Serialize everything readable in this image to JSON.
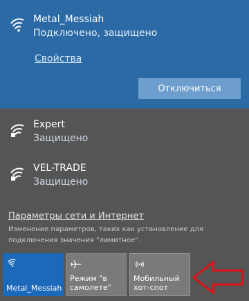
{
  "connected_network": {
    "name": "Metal_Messiah",
    "status": "Подключено, защищено",
    "properties_link": "Свойства",
    "disconnect_button": "Отключиться",
    "icon": "wifi-icon"
  },
  "networks": [
    {
      "name": "Expert",
      "status": "Защищено",
      "icon": "wifi-secured-icon"
    },
    {
      "name": "VEL-TRADE",
      "status": "Защищено",
      "icon": "wifi-secured-icon"
    }
  ],
  "settings": {
    "link": "Параметры сети и Интернет",
    "description": "Изменение параметров, таких как установление для подключения значения \"лимитное\"."
  },
  "quick_actions": [
    {
      "label": "Metal_Messiah",
      "icon": "wifi-icon",
      "active": true
    },
    {
      "label": "Режим \"в самолете\"",
      "icon": "airplane-icon",
      "active": false
    },
    {
      "label": "Мобильный хот-спот",
      "icon": "hotspot-icon",
      "active": false
    }
  ],
  "colors": {
    "panel_background": "#555555",
    "connected_background": "#2c6aa5",
    "active_tile": "#1b69b8",
    "inactive_tile": "#7a7a7a",
    "annotation_arrow": "#e0101a"
  }
}
